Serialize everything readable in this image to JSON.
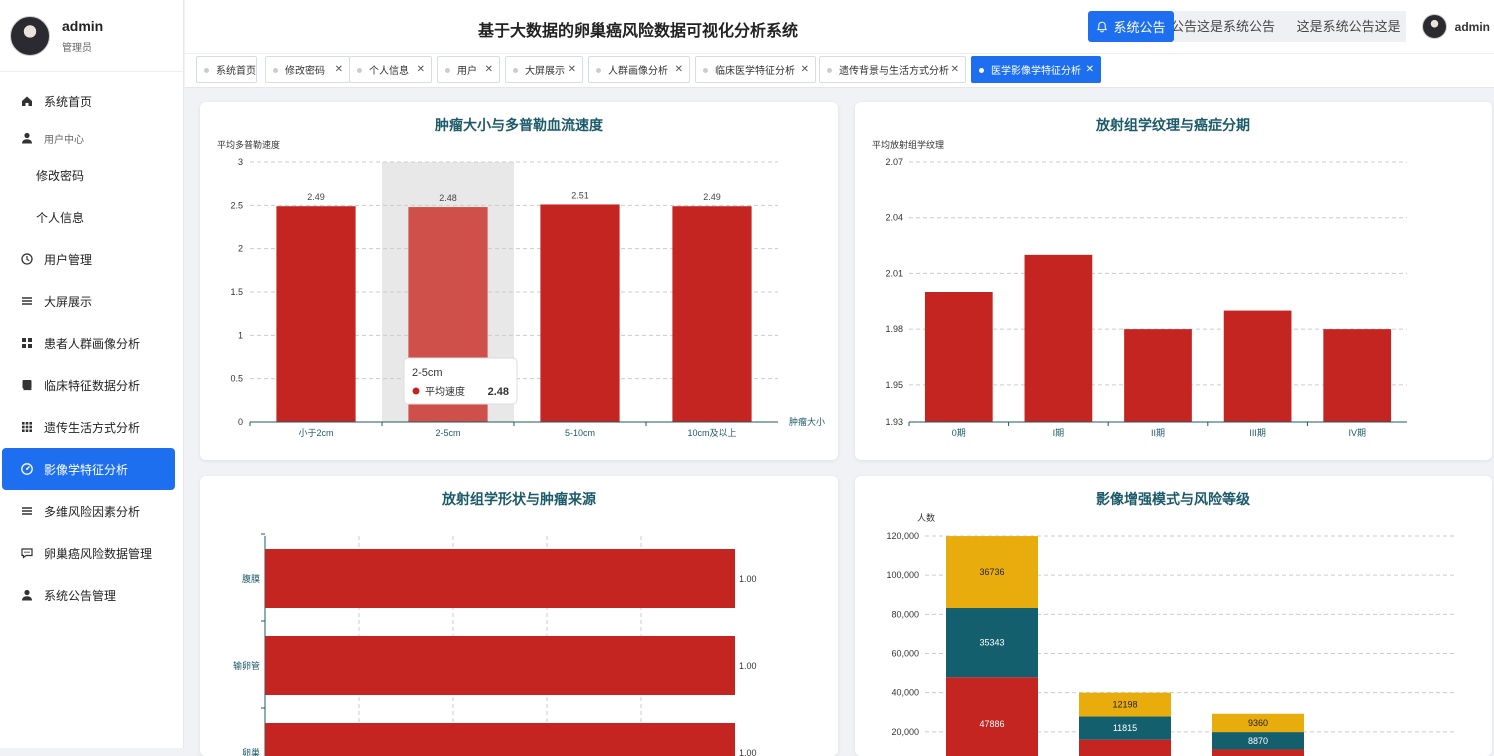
{
  "sidebar": {
    "user": "admin",
    "role": "管理员",
    "items": [
      {
        "label": "系统首页",
        "icon": "home-icon",
        "type": "item"
      },
      {
        "label": "用户中心",
        "icon": "person-icon",
        "type": "group"
      },
      {
        "label": "修改密码",
        "icon": "",
        "type": "sub"
      },
      {
        "label": "个人信息",
        "icon": "",
        "type": "sub"
      },
      {
        "label": "用户管理",
        "icon": "clock-icon",
        "type": "item"
      },
      {
        "label": "大屏展示",
        "icon": "list-icon",
        "type": "item"
      },
      {
        "label": "患者人群画像分析",
        "icon": "grid-icon",
        "type": "item"
      },
      {
        "label": "临床特征数据分析",
        "icon": "book-icon",
        "type": "item"
      },
      {
        "label": "遗传生活方式分析",
        "icon": "apps-icon",
        "type": "item"
      },
      {
        "label": "影像学特征分析",
        "icon": "gauge-icon",
        "type": "item",
        "active": true
      },
      {
        "label": "多维风险因素分析",
        "icon": "list-icon",
        "type": "item"
      },
      {
        "label": "卵巢癌风险数据管理",
        "icon": "chat-icon",
        "type": "item"
      },
      {
        "label": "系统公告管理",
        "icon": "person-icon",
        "type": "item"
      }
    ]
  },
  "header": {
    "title": "基于大数据的卵巢癌风险数据可视化分析系统",
    "notice_label": "系统公告",
    "marquee": "公告这是系统公告      这是系统公告这是",
    "user": "admin"
  },
  "tabs": [
    {
      "label": "系统首页",
      "closable": false
    },
    {
      "label": "修改密码",
      "closable": true
    },
    {
      "label": "个人信息",
      "closable": true
    },
    {
      "label": "用户",
      "closable": true
    },
    {
      "label": "大屏展示",
      "closable": true
    },
    {
      "label": "人群画像分析",
      "closable": true
    },
    {
      "label": "临床医学特征分析",
      "closable": true
    },
    {
      "label": "遗传背景与生活方式分析",
      "closable": true
    },
    {
      "label": "医学影像学特征分析",
      "closable": true,
      "active": true
    }
  ],
  "colors": {
    "red": "#c42521",
    "highlight": "#cf4f4b",
    "teal": "#145f6d",
    "gold": "#e8ad0c",
    "accent": "#1e6ff0",
    "title": "#1c5a6a"
  },
  "chart_data": [
    {
      "type": "bar",
      "title": "肿瘤大小与多普勒血流速度",
      "ylabel": "平均多普勒速度",
      "xlabel": "肿瘤大小",
      "categories": [
        "小于2cm",
        "2-5cm",
        "5-10cm",
        "10cm及以上"
      ],
      "values": [
        2.49,
        2.48,
        2.51,
        2.49
      ],
      "ylim": [
        0,
        3
      ],
      "yticks": [
        "0",
        "0.5",
        "1",
        "1.5",
        "2",
        "2.5",
        "3"
      ],
      "grid": true,
      "highlight_index": 1,
      "tooltip": {
        "title": "2-5cm",
        "series": "平均速度",
        "value": "2.48"
      }
    },
    {
      "type": "bar",
      "title": "放射组学纹理与癌症分期",
      "ylabel": "平均放射组学纹理",
      "categories": [
        "0期",
        "I期",
        "II期",
        "III期",
        "IV期"
      ],
      "values": [
        2.0,
        2.02,
        1.98,
        1.99,
        1.98
      ],
      "ylim": [
        1.93,
        2.07
      ],
      "yticks": [
        "1.93",
        "1.95",
        "1.98",
        "2.01",
        "2.04",
        "2.07"
      ],
      "grid": true
    },
    {
      "type": "bar",
      "orientation": "horizontal",
      "title": "放射组学形状与肿瘤来源",
      "categories": [
        "腹膜",
        "输卵管",
        "卵巢"
      ],
      "values": [
        1.0,
        1.0,
        1.0
      ],
      "labels": [
        "1.00",
        "1.00",
        "1.00"
      ],
      "grid": true
    },
    {
      "type": "bar",
      "stacked": true,
      "title": "影像增强模式与风险等级",
      "ylabel": "人数",
      "yticks": [
        "0",
        "20,000",
        "40,000",
        "60,000",
        "80,000",
        "100,000",
        "120,000"
      ],
      "ylim": [
        0,
        120000
      ],
      "grid": true,
      "groups": [
        {
          "values": [
            47886,
            35343,
            36736
          ]
        },
        {
          "values": [
            16000,
            11815,
            12198
          ]
        },
        {
          "values": [
            11000,
            8870,
            9360
          ]
        }
      ]
    }
  ]
}
